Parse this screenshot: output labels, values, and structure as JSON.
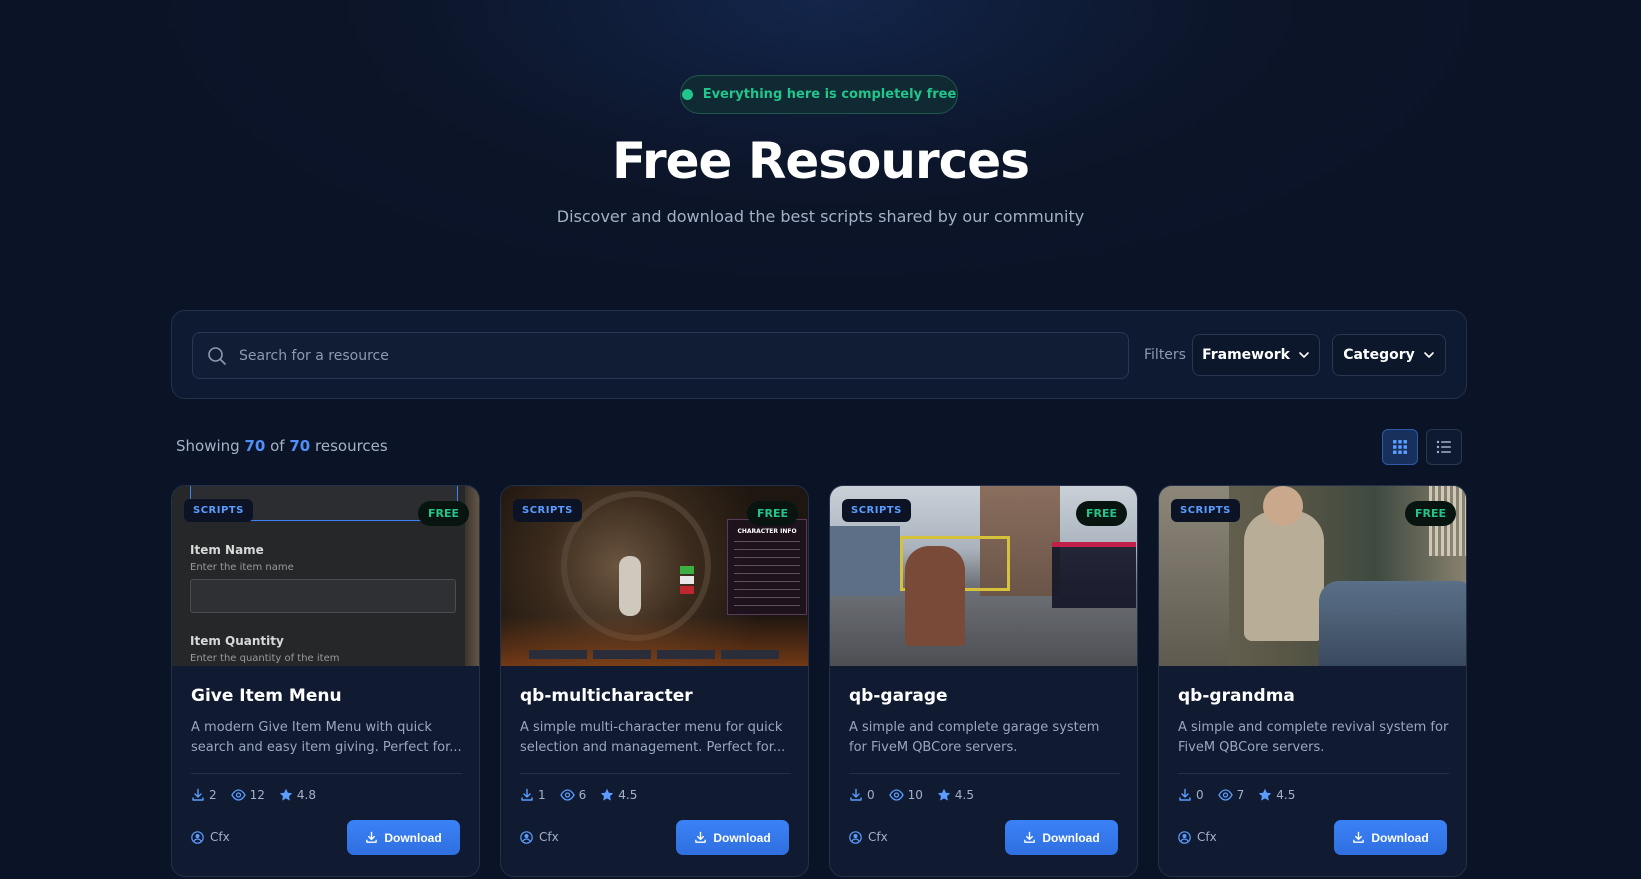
{
  "hero": {
    "pill_text": "Everything here is completely free",
    "title": "Free Resources",
    "subtitle": "Discover and download the best scripts shared by our community"
  },
  "filters": {
    "search_placeholder": "Search for a resource",
    "label": "Filters",
    "framework": "Framework",
    "category": "Category"
  },
  "results": {
    "prefix": "Showing",
    "shown": "70",
    "of": "of",
    "total": "70",
    "suffix": "resources"
  },
  "view_modes": [
    "grid",
    "list"
  ],
  "colors": {
    "accent": "#3b82f6",
    "free": "#22c58b",
    "background": "#0b1427"
  },
  "cards": [
    {
      "category": "SCRIPTS",
      "price": "FREE",
      "title": "Give Item Menu",
      "description": "A modern Give Item Menu with quick search and easy item giving. Perfect for...",
      "downloads": "2",
      "views": "12",
      "rating": "4.8",
      "author": "Cfx",
      "button": "Download",
      "preview": {
        "field1_label": "Item Name",
        "field1_hint": "Enter the item name",
        "field2_label": "Item Quantity",
        "field2_hint": "Enter the quantity of the item"
      }
    },
    {
      "category": "SCRIPTS",
      "price": "FREE",
      "title": "qb-multicharacter",
      "description": "A simple multi-character menu for quick selection and management. Perfect for...",
      "downloads": "1",
      "views": "6",
      "rating": "4.5",
      "author": "Cfx",
      "button": "Download",
      "preview": {
        "panel_title": "CHARACTER INFO"
      }
    },
    {
      "category": "SCRIPTS",
      "price": "FREE",
      "title": "qb-garage",
      "description": "A simple and complete garage system for FiveM QBCore servers.",
      "downloads": "0",
      "views": "10",
      "rating": "4.5",
      "author": "Cfx",
      "button": "Download"
    },
    {
      "category": "SCRIPTS",
      "price": "FREE",
      "title": "qb-grandma",
      "description": "A simple and complete revival system for FiveM QBCore servers.",
      "downloads": "0",
      "views": "7",
      "rating": "4.5",
      "author": "Cfx",
      "button": "Download"
    }
  ]
}
